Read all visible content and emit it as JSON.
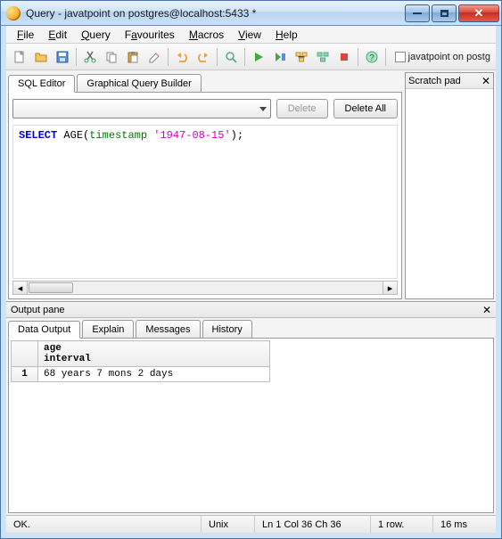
{
  "window": {
    "title": "Query - javatpoint on postgres@localhost:5433 *"
  },
  "menubar": [
    {
      "label": "File",
      "ul": "F"
    },
    {
      "label": "Edit",
      "ul": "E"
    },
    {
      "label": "Query",
      "ul": "Q"
    },
    {
      "label": "Favourites",
      "ul": "a"
    },
    {
      "label": "Macros",
      "ul": "M"
    },
    {
      "label": "View",
      "ul": "V"
    },
    {
      "label": "Help",
      "ul": "H"
    }
  ],
  "toolbar": {
    "connection_label": "javatpoint on postg"
  },
  "editor": {
    "tabs": {
      "sql": "SQL Editor",
      "gqb": "Graphical Query Builder"
    },
    "delete_btn": "Delete",
    "delete_all_btn": "Delete All",
    "query_kw": "SELECT",
    "query_fn": "AGE",
    "query_ident": "timestamp",
    "query_str": "'1947-08-15'",
    "query_prefix": " ",
    "query_open": "(",
    "query_sep": " ",
    "query_close": ");"
  },
  "scratch": {
    "title": "Scratch pad"
  },
  "output": {
    "pane_title": "Output pane",
    "tabs": [
      "Data Output",
      "Explain",
      "Messages",
      "History"
    ],
    "col_name": "age",
    "col_type": "interval",
    "row_num": "1",
    "row_value": "68 years 7 mons 2 days"
  },
  "status": {
    "msg": "OK.",
    "enc": "Unix",
    "pos": "Ln 1 Col 36 Ch 36",
    "rows": "1 row.",
    "time": "16 ms"
  }
}
